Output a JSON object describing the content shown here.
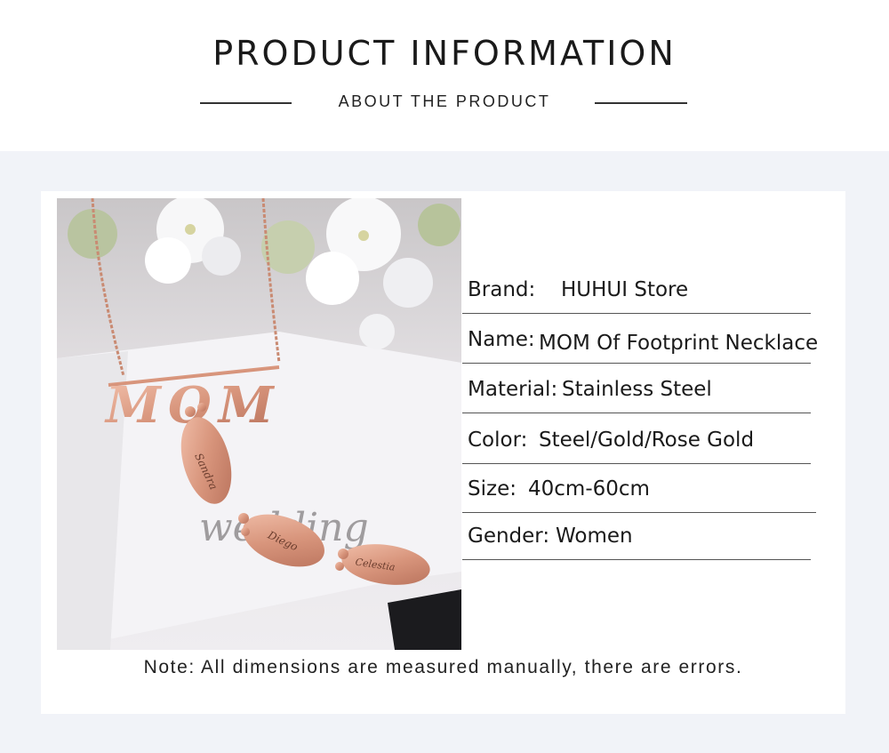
{
  "header": {
    "title": "PRODUCT INFORMATION",
    "subtitle": "ABOUT THE PRODUCT"
  },
  "product_image": {
    "engraving": "MOM",
    "footprint_names": [
      "Sandra",
      "Diego",
      "Celestia"
    ],
    "background_script": "wedding"
  },
  "specs": [
    {
      "label": "Brand:",
      "value": "HUHUI Store"
    },
    {
      "label": "Name:",
      "value": "MOM Of Footprint Necklace"
    },
    {
      "label": "Material:",
      "value": "Stainless Steel"
    },
    {
      "label": "Color:",
      "value": "Steel/Gold/Rose Gold"
    },
    {
      "label": "Size:",
      "value": "40cm-60cm"
    },
    {
      "label": "Gender:",
      "value": "Women"
    }
  ],
  "note": "Note: All dimensions are measured manually, there are errors."
}
